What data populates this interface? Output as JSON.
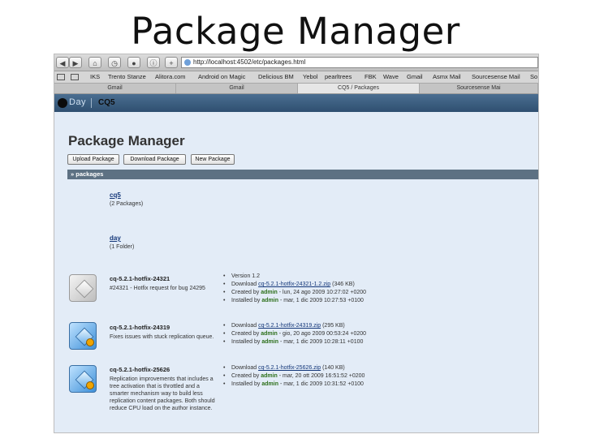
{
  "slide": {
    "title": "Package Manager"
  },
  "browser": {
    "url": "http://localhost:4502/etc/packages.html",
    "bookmarks": [
      "IKS",
      "Trento Stanze",
      "Alitora.com",
      "Android on Magic",
      "Delicious BM",
      "Yebol",
      "pearltrees",
      "FBK",
      "Wave",
      "Gmail",
      "Asmx Mail",
      "Sourcesense Mail",
      "So"
    ],
    "tabs": [
      "Gmail",
      "Gmail",
      "CQ5 / Packages",
      "Sourcesense Mai"
    ]
  },
  "app": {
    "vendor": "Day",
    "product": "CQ5",
    "page_title": "Package Manager",
    "buttons": [
      "Upload Package",
      "Download Package",
      "New Package"
    ],
    "breadcrumb": "» packages"
  },
  "folders": [
    {
      "name": "cq5",
      "sub": "(2 Packages)"
    },
    {
      "name": "day",
      "sub": "(1 Folder)"
    }
  ],
  "packages": [
    {
      "name": "cq-5.2.1-hotfix-24321",
      "desc": "#24321 - Hotfix request for bug 24295",
      "icon": "package-gray-icon",
      "version": "Version 1.2",
      "download_prefix": "Download",
      "download_file": "cq-5.2.1-hotfix-24321-1.2.zip",
      "download_size": "(346 KB)",
      "created_prefix": "Created by",
      "created_user": "admin",
      "created_date": "- lun, 24 ago 2009 10:27:02 +0200",
      "installed_prefix": "Installed by",
      "installed_user": "admin",
      "installed_date": "- mar, 1 dic 2009 10:27:53 +0100"
    },
    {
      "name": "cq-5.2.1-hotfix-24319",
      "desc": "Fixes issues with stuck replication queue.",
      "icon": "package-blue-icon",
      "download_prefix": "Download",
      "download_file": "cq-5.2.1-hotfix-24319.zip",
      "download_size": "(295 KB)",
      "created_prefix": "Created by",
      "created_user": "admin",
      "created_date": "- gio, 20 ago 2009 00:53:24 +0200",
      "installed_prefix": "Installed by",
      "installed_user": "admin",
      "installed_date": "- mar, 1 dic 2009 10:28:11 +0100"
    },
    {
      "name": "cq-5.2.1-hotfix-25626",
      "desc": "Replication improvements that includes a tree activation that is throttled and a smarter mechanism way to build less replication content packages. Both should reduce CPU load on the author instance.",
      "icon": "package-blue-icon",
      "download_prefix": "Download",
      "download_file": "cq-5.2.1-hotfix-25626.zip",
      "download_size": "(140 KB)",
      "created_prefix": "Created by",
      "created_user": "admin",
      "created_date": "- mar, 20 ott 2009 16:51:52 +0200",
      "installed_prefix": "Installed by",
      "installed_user": "admin",
      "installed_date": "- mar, 1 dic 2009 10:31:52 +0100"
    }
  ]
}
